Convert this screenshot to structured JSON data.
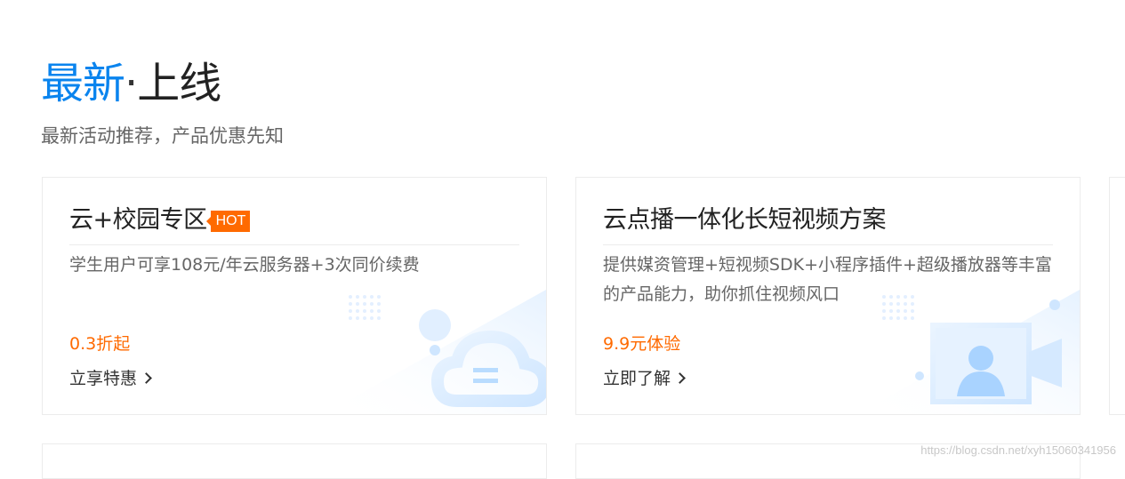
{
  "section": {
    "title_accent": "最新",
    "title_dot": "·",
    "title_rest": "上线",
    "subtitle": "最新活动推荐，产品优惠先知"
  },
  "cards": [
    {
      "title": "云+校园专区",
      "badge": "HOT",
      "description": "学生用户可享108元/年云服务器+3次同价续费",
      "price": "0.3折起",
      "link_label": "立享特惠",
      "illustration_icon": "cloud-icon"
    },
    {
      "title": "云点播一体化长短视频方案",
      "description": "提供媒资管理+短视频SDK+小程序插件+超级播放器等丰富的产品能力，助你抓住视频风口",
      "price": "9.9元体验",
      "link_label": "立即了解",
      "illustration_icon": "video-user-icon"
    }
  ],
  "colors": {
    "accent_blue": "#0a84ee",
    "price_orange": "#ff6a00",
    "badge_orange": "#ff6a00"
  },
  "watermark": "https://blog.csdn.net/xyh15060341956"
}
